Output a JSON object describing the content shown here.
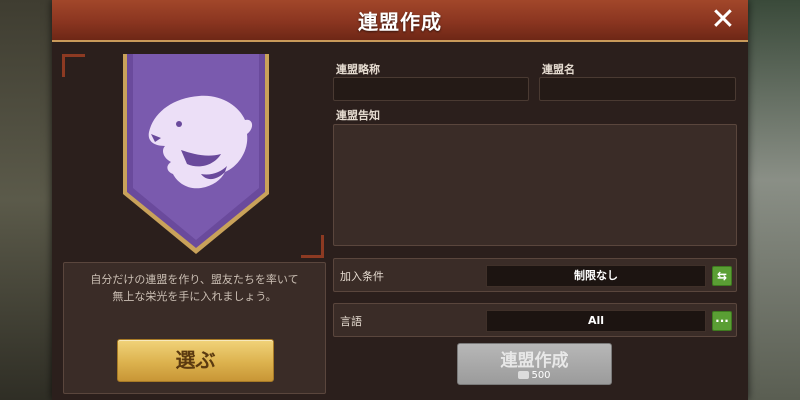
{
  "dialog": {
    "title": "連盟作成",
    "close_icon": "close-icon"
  },
  "banner": {
    "flag_color": "#6a4a9c",
    "trim_color": "#c9a25a",
    "emblem_icon": "bear-head-icon"
  },
  "description": {
    "line1": "自分だけの連盟を作り、盟友たちを率いて",
    "line2": "無上な栄光を手に入れましょう。"
  },
  "choose_button": {
    "label": "選ぶ"
  },
  "form": {
    "abbr_label": "連盟略称",
    "abbr_value": "",
    "name_label": "連盟名",
    "name_value": "",
    "notice_label": "連盟告知",
    "notice_value": ""
  },
  "join_condition": {
    "label": "加入条件",
    "value": "制限なし",
    "icon": "swap-arrows-icon"
  },
  "language": {
    "label": "言語",
    "value": "All",
    "icon": "more-dots-icon"
  },
  "create_button": {
    "label": "連盟作成",
    "cost": "500",
    "cost_icon": "resource-icon"
  }
}
